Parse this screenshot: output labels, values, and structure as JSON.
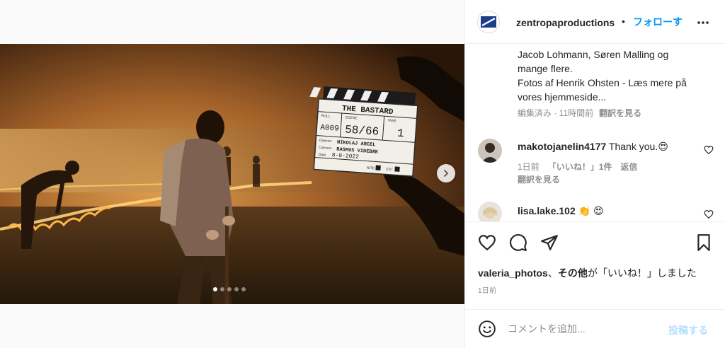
{
  "post": {
    "username": "zentropaproductions",
    "separator": "•",
    "follow_label": "フォローす",
    "more_icon": "more-horizontal-icon"
  },
  "caption": {
    "lines": [
      "Jacob Lohmann, Søren Malling og",
      "mange flere.",
      "Fotos af Henrik Ohsten - Læs mere på",
      "vores hjemmeside..."
    ],
    "meta": "編集済み · 11時間前",
    "translate_label": "翻訳を見る"
  },
  "comments": [
    {
      "username": "makotojanelin4177",
      "text": "Thank you.",
      "emoji": "😍",
      "time": "1日前",
      "likes": "「いいね！」1件",
      "reply": "返信",
      "translate": "翻訳を見る"
    },
    {
      "username": "lisa.lake.102",
      "emoji": "👏 😍"
    }
  ],
  "clapboard": {
    "title": "THE BASTARD",
    "roll_label": "ROLL",
    "scene_label": "SCENE",
    "take_label": "TAKE",
    "roll": "A009",
    "scene": "58/66",
    "take": "1",
    "director_label": "Director",
    "director": "NIKOLAJ ARCEL",
    "camera_label": "Camera",
    "camera": "RASMUS VIDEBÆK",
    "date_label": "Date",
    "date": "8-9-2022",
    "nite_label": "NITE",
    "ext_label": "EXT"
  },
  "carousel": {
    "current": 1,
    "total": 5
  },
  "likes": {
    "user": "valeria_photos",
    "sep": "、",
    "others": "その他",
    "suffix": "が「いいね！」しました"
  },
  "timestamp": "1日前",
  "comment_box": {
    "placeholder": "コメントを追加...",
    "post_label": "投稿する"
  },
  "colors": {
    "link_blue": "#0095f6",
    "muted": "#8e8e8e",
    "post_disabled": "#b2dffc",
    "text": "#262626"
  }
}
